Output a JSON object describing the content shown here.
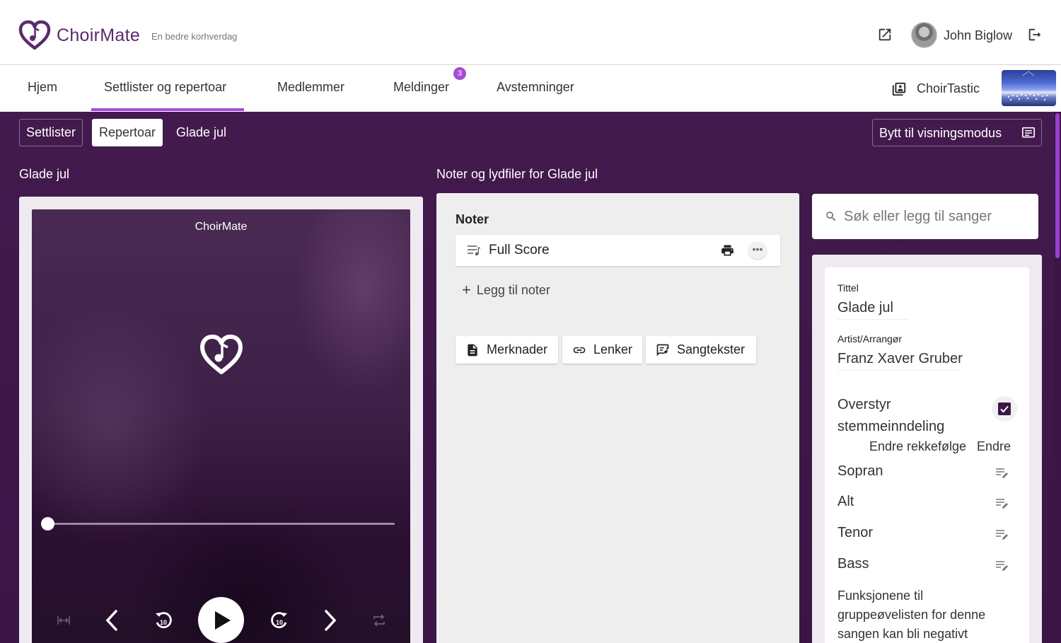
{
  "app": {
    "name": "ChoirMate",
    "tagline": "En bedre korhverdag",
    "user_name": "John Biglow"
  },
  "nav": {
    "tabs": [
      {
        "label": "Hjem"
      },
      {
        "label": "Settlister og repertoar",
        "active": true
      },
      {
        "label": "Medlemmer"
      },
      {
        "label": "Meldinger",
        "badge": "3"
      },
      {
        "label": "Avstemninger"
      }
    ],
    "choir_name": "ChoirTastic"
  },
  "subnav": {
    "items": [
      {
        "label": "Settlister"
      },
      {
        "label": "Repertoar",
        "active": true
      },
      {
        "label": "Glade jul"
      }
    ],
    "view_mode_label": "Bytt til visningsmodus"
  },
  "left_section": {
    "title": "Glade jul",
    "player": {
      "title": "ChoirMate",
      "progress": 0
    }
  },
  "notes_section": {
    "title": "Noter og lydfiler for Glade jul",
    "heading": "Noter",
    "files": [
      {
        "label": "Full Score"
      }
    ],
    "add_label": "Legg til noter",
    "buttons": [
      {
        "label": "Merknader",
        "icon": "document-icon"
      },
      {
        "label": "Lenker",
        "icon": "link-icon"
      },
      {
        "label": "Sangtekster",
        "icon": "lyrics-icon"
      }
    ]
  },
  "search": {
    "placeholder": "Søk eller legg til sanger"
  },
  "details": {
    "title_label": "Tittel",
    "title_value": "Glade jul",
    "artist_label": "Artist/Arrangør",
    "artist_value": "Franz Xaver Gruber",
    "override_label": "Overstyr stemmeinndeling",
    "override_checked": true,
    "reorder_label": "Endre rekkefølge",
    "edit_label": "Endre",
    "voices": [
      {
        "label": "Sopran"
      },
      {
        "label": "Alt"
      },
      {
        "label": "Tenor"
      },
      {
        "label": "Bass"
      }
    ],
    "note_text": "Funksjonene til gruppeøvelisten for denne sangen kan bli negativt"
  },
  "colors": {
    "brand_purple": "#5b2a6e",
    "accent": "#a64bd6",
    "background": "#431a4d"
  }
}
